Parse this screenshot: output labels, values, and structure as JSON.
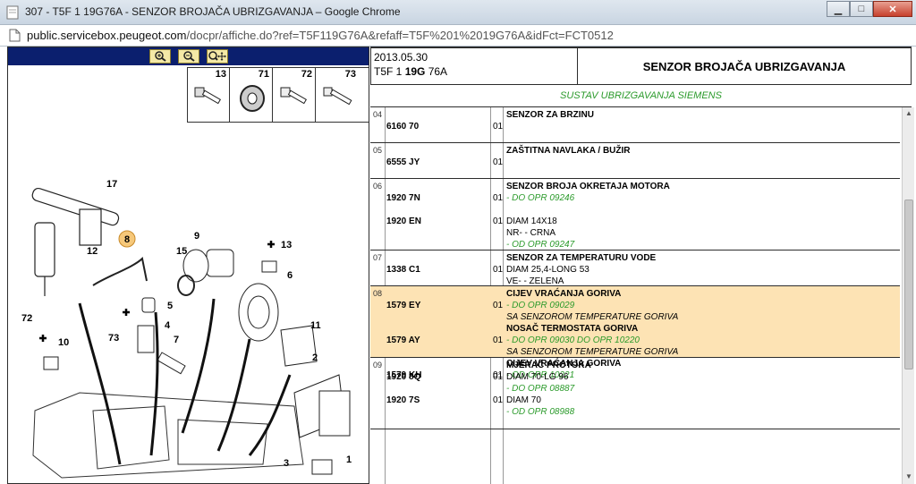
{
  "window": {
    "title": "307 - T5F 1 19G76A - SENZOR BROJAČA UBRIZGAVANJA – Google Chrome",
    "minimize": "▁",
    "maximize": "□",
    "close": "✕"
  },
  "urlbar": {
    "host": "public.servicebox.peugeot.com",
    "path": "/docpr/affiche.do?ref=T5F119G76A&refaff=T5F%201%2019G76A&idFct=FCT0512"
  },
  "diagram": {
    "zoom_buttons": [
      "zoom-in-icon",
      "zoom-out-icon",
      "zoom-pan-icon"
    ],
    "parts_box": [
      "13",
      "71",
      "72",
      "73"
    ],
    "callouts": [
      "17",
      "8",
      "12",
      "9",
      "13",
      "15",
      "6",
      "72",
      "5",
      "73",
      "4",
      "11",
      "10",
      "7",
      "2",
      "3",
      "1",
      "71"
    ]
  },
  "header": {
    "date": "2013.05.30",
    "code_prefix": "T5F 1 ",
    "code_bold": "19G",
    "code_suffix": " 76A",
    "title": "SENZOR BROJAČA UBRIZGAVANJA"
  },
  "system": "SUSTAV UBRIZGAVANJA SIEMENS",
  "rows": [
    {
      "grp": "04",
      "lines": [
        {
          "ref": "",
          "qty": "",
          "desc": "SENZOR ZA BRZINU",
          "style": "name"
        },
        {
          "ref": "6160 70",
          "qty": "01",
          "desc": "",
          "style": ""
        }
      ]
    },
    {
      "grp": "05",
      "lines": [
        {
          "ref": "",
          "qty": "",
          "desc": "ZAŠTITNA NAVLAKA / BUŽIR",
          "style": "name"
        },
        {
          "ref": "6555 JY",
          "qty": "01",
          "desc": "",
          "style": ""
        }
      ]
    },
    {
      "grp": "06",
      "lines": [
        {
          "ref": "",
          "qty": "",
          "desc": "SENZOR BROJA OKRETAJA MOTORA",
          "style": "name"
        },
        {
          "ref": "1920 7N",
          "qty": "01",
          "desc": "- DO OPR 09246",
          "style": "green"
        },
        {
          "ref": "",
          "qty": "",
          "desc": "",
          "style": ""
        },
        {
          "ref": "1920 EN",
          "qty": "01",
          "desc": "DIAM 14X18",
          "style": ""
        },
        {
          "ref": "",
          "qty": "",
          "desc": "NR- - CRNA",
          "style": ""
        },
        {
          "ref": "",
          "qty": "",
          "desc": "- OD OPR 09247",
          "style": "green"
        }
      ]
    },
    {
      "grp": "07",
      "lines": [
        {
          "ref": "",
          "qty": "",
          "desc": "SENZOR ZA TEMPERATURU VODE",
          "style": "name"
        },
        {
          "ref": "1338 C1",
          "qty": "01",
          "desc": "DIAM 25,4-LONG 53",
          "style": ""
        },
        {
          "ref": "",
          "qty": "",
          "desc": "VE- - ZELENA",
          "style": ""
        }
      ]
    },
    {
      "grp": "08",
      "lines": [
        {
          "ref": "",
          "qty": "",
          "desc": "CIJEV VRAĆANJA GORIVA",
          "style": "name"
        },
        {
          "ref": "1579 EY",
          "qty": "01",
          "desc": "- DO OPR 09029",
          "style": "green"
        },
        {
          "ref": "",
          "qty": "",
          "desc": "SA SENZOROM TEMPERATURE GORIVA",
          "style": "sub"
        },
        {
          "ref": "",
          "qty": "",
          "desc": "NOSAČ TERMOSTATA GORIVA",
          "style": "name"
        },
        {
          "ref": "1579 AY",
          "qty": "01",
          "desc": "- DO OPR 09030 DO OPR 10220",
          "style": "green"
        },
        {
          "ref": "",
          "qty": "",
          "desc": "SA SENZOROM TEMPERATURE GORIVA",
          "style": "sub"
        },
        {
          "ref": "",
          "qty": "",
          "desc": "CIJEV VRAĆANJA GORIVA",
          "style": "name"
        },
        {
          "ref": "1579 KH",
          "qty": "01",
          "desc": "- OD OPR 10221",
          "style": "green"
        }
      ]
    },
    {
      "grp": "09",
      "lines": [
        {
          "ref": "",
          "qty": "",
          "desc": "MJERAČ PROTOKA",
          "style": "name"
        },
        {
          "ref": "1920 8Q",
          "qty": "01",
          "desc": "DIAM 70-LG 96",
          "style": ""
        },
        {
          "ref": "",
          "qty": "",
          "desc": "- DO OPR 08887",
          "style": "green"
        },
        {
          "ref": "1920 7S",
          "qty": "01",
          "desc": "DIAM 70",
          "style": ""
        },
        {
          "ref": "",
          "qty": "",
          "desc": "- OD OPR 08988",
          "style": "green"
        }
      ]
    }
  ]
}
